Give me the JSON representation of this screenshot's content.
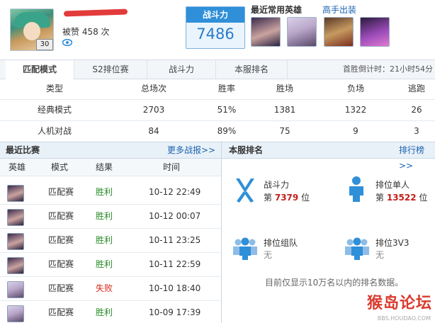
{
  "profile": {
    "level": "30",
    "likes_text": "被赞 458 次"
  },
  "power": {
    "title": "战斗力",
    "value": "7486"
  },
  "recent_heroes_label": "最近常用英雄",
  "master_link": "高手出装",
  "tabs": [
    {
      "label": "匹配模式",
      "active": true
    },
    {
      "label": "S2排位赛",
      "active": false
    },
    {
      "label": "战斗力",
      "active": false
    },
    {
      "label": "本服排名",
      "active": false
    }
  ],
  "countdown": "首胜倒计时：21小时54分",
  "stats": {
    "headers": [
      "类型",
      "总场次",
      "胜率",
      "胜场",
      "负场",
      "逃跑"
    ],
    "rows": [
      [
        "经典模式",
        "2703",
        "51%",
        "1381",
        "1322",
        "26"
      ],
      [
        "人机对战",
        "84",
        "89%",
        "75",
        "9",
        "3"
      ]
    ]
  },
  "recent_matches": {
    "title": "最近比赛",
    "more_link": "更多战报>>",
    "headers": [
      "英雄",
      "模式",
      "结果",
      "时间"
    ],
    "rows": [
      {
        "mode": "匹配赛",
        "result": "胜利",
        "win": true,
        "time": "10-12 22:49"
      },
      {
        "mode": "匹配赛",
        "result": "胜利",
        "win": true,
        "time": "10-12 00:07"
      },
      {
        "mode": "匹配赛",
        "result": "胜利",
        "win": true,
        "time": "10-11 23:25"
      },
      {
        "mode": "匹配赛",
        "result": "胜利",
        "win": true,
        "time": "10-11 22:59"
      },
      {
        "mode": "匹配赛",
        "result": "失败",
        "win": false,
        "time": "10-10 18:40"
      },
      {
        "mode": "匹配赛",
        "result": "胜利",
        "win": true,
        "time": "10-09 17:39"
      }
    ]
  },
  "server_rank": {
    "title": "本服排名",
    "more_link": "排行榜>>",
    "items": [
      {
        "label": "战斗力",
        "prefix": "第",
        "rank": "7379",
        "suffix": "位",
        "icon": "sword-icon"
      },
      {
        "label": "排位单人",
        "prefix": "第",
        "rank": "13522",
        "suffix": "位",
        "icon": "person-icon"
      },
      {
        "label": "排位组队",
        "value": "无",
        "icon": "group-icon"
      },
      {
        "label": "排位3V3",
        "value": "无",
        "icon": "team3v3-icon"
      }
    ],
    "note": "目前仅显示10万名以内的排名数据。"
  },
  "watermark": {
    "text": "猴岛论坛",
    "sub": "BBS.HOUDAO.COM"
  },
  "colors": {
    "accent": "#2f8fd8",
    "win": "#2a8c2a",
    "lose": "#d8281e",
    "rank": "#c0201a"
  }
}
